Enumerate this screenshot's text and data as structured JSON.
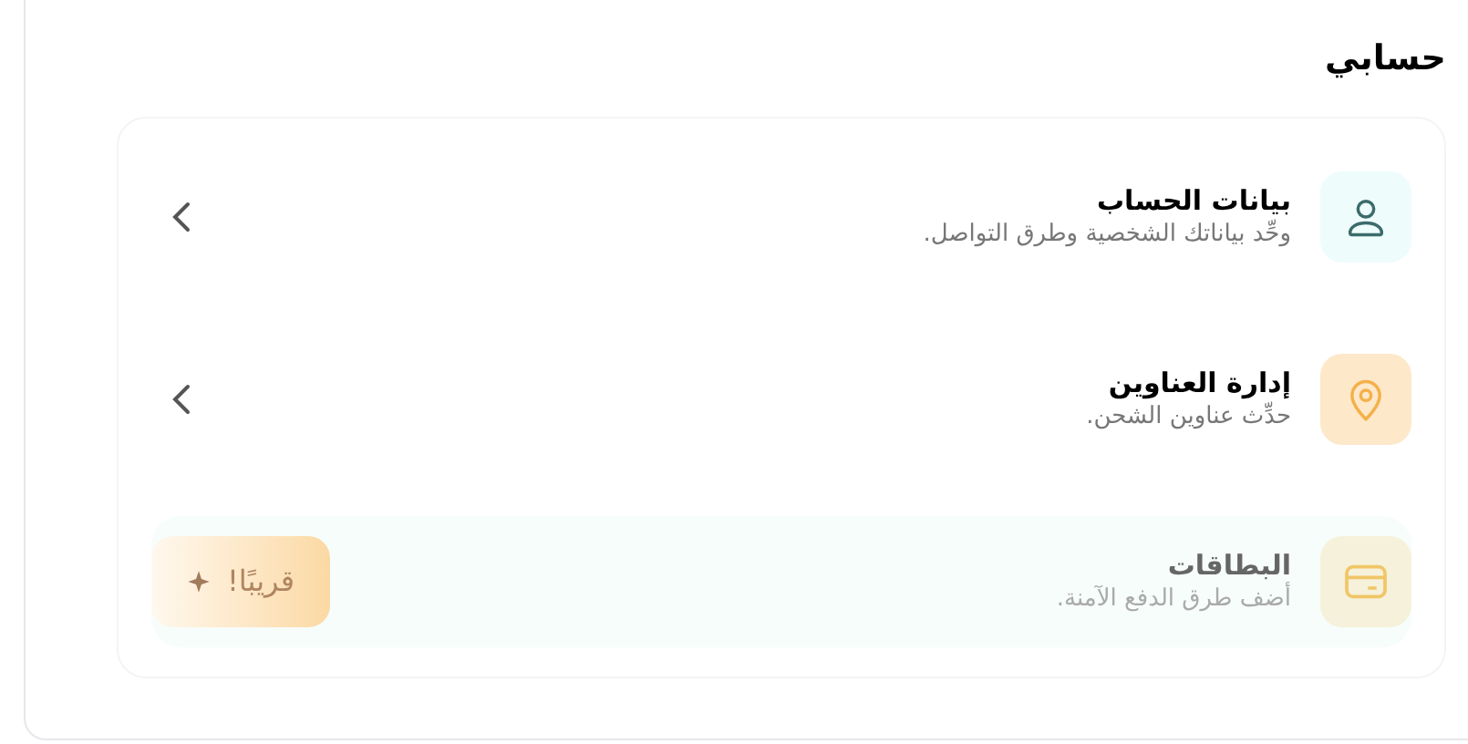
{
  "section_title": "حسابي",
  "items": [
    {
      "title": "بيانات الحساب",
      "subtitle": "وحِّد بياناتك الشخصية وطرق التواصل.",
      "kind": "person",
      "disabled": false
    },
    {
      "title": "إدارة العناوين",
      "subtitle": "حدِّث عناوين الشحن.",
      "kind": "pin",
      "disabled": false
    },
    {
      "title": "البطاقات",
      "subtitle": "أضف طرق الدفع الآمنة.",
      "kind": "card",
      "disabled": true,
      "badge": "قريبًا!"
    }
  ]
}
